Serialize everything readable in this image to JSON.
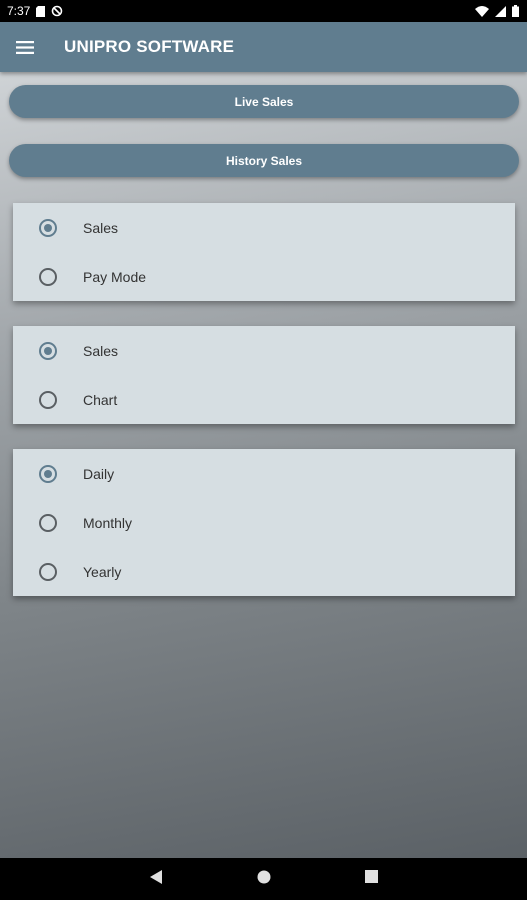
{
  "status_bar": {
    "time": "7:37",
    "left_icons": [
      "sim-card-icon",
      "data-saver-icon"
    ],
    "right_icons": [
      "wifi-icon",
      "signal-icon",
      "battery-icon"
    ]
  },
  "app_bar": {
    "title": "UNIPRO SOFTWARE",
    "menu_icon": "hamburger-menu-icon",
    "color": "#607d8f"
  },
  "buttons": {
    "live_sales": "Live Sales",
    "history_sales": "History Sales"
  },
  "groups": [
    {
      "options": [
        {
          "label": "Sales",
          "checked": true
        },
        {
          "label": "Pay Mode",
          "checked": false
        }
      ]
    },
    {
      "options": [
        {
          "label": "Sales",
          "checked": true
        },
        {
          "label": "Chart",
          "checked": false
        }
      ]
    },
    {
      "options": [
        {
          "label": "Daily",
          "checked": true
        },
        {
          "label": "Monthly",
          "checked": false
        },
        {
          "label": "Yearly",
          "checked": false
        }
      ]
    }
  ],
  "nav_bar": {
    "icons": [
      "back-icon",
      "home-icon",
      "recents-icon"
    ]
  }
}
